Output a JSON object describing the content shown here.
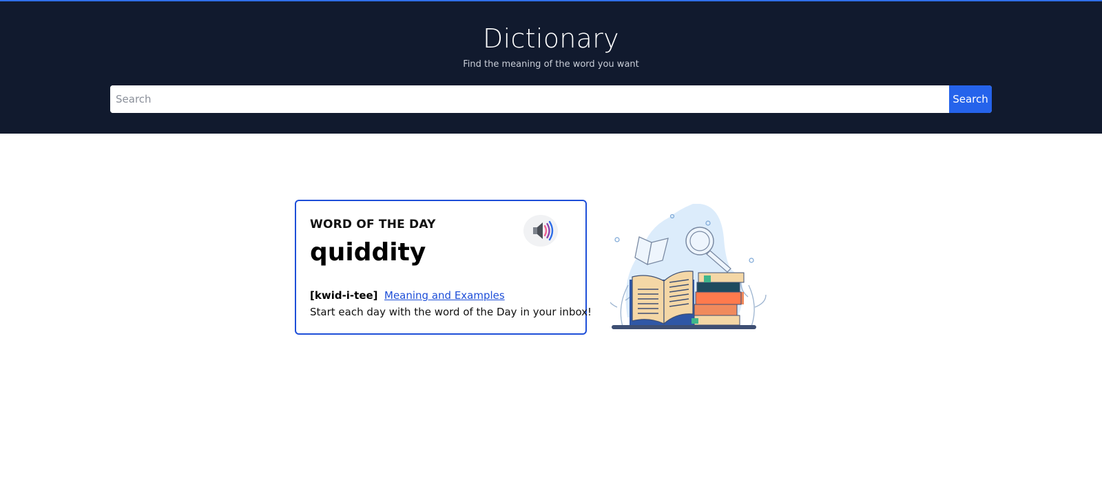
{
  "header": {
    "title": "Dictionary",
    "subtitle": "Find the meaning of the word you want"
  },
  "search": {
    "placeholder": "Search",
    "value": "",
    "button_label": "Search"
  },
  "word_of_the_day": {
    "label": "WORD OF THE DAY",
    "word": "quiddity",
    "pronunciation": "[kwid-i-tee]",
    "link_label": "Meaning and Examples",
    "tagline": "Start each day with the word of the Day in your inbox!",
    "audio_icon": "speaker-icon"
  },
  "illustration": {
    "icon": "books-illustration"
  },
  "colors": {
    "header_bg": "#111a2e",
    "accent": "#2563eb",
    "card_border": "#1d4ed8",
    "link": "#1d4ed8"
  }
}
